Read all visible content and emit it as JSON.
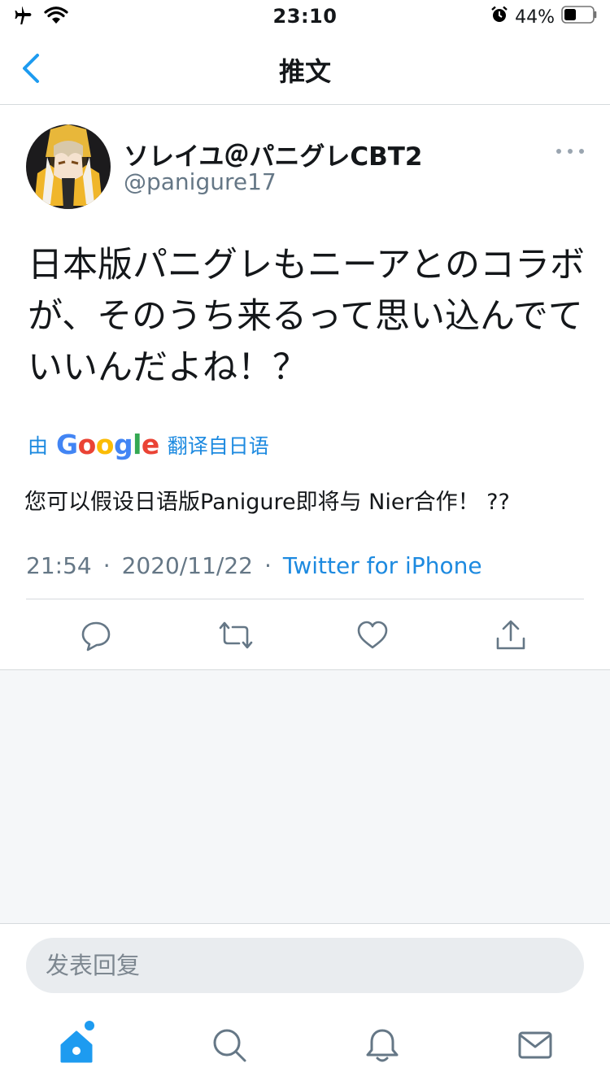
{
  "status_bar": {
    "time": "23:10",
    "battery_percent": "44%",
    "battery_level": 0.44,
    "icons": [
      "airplane-icon",
      "wifi-icon",
      "alarm-icon",
      "battery-icon"
    ]
  },
  "nav": {
    "title": "推文",
    "back_icon": "chevron-left-icon"
  },
  "tweet": {
    "author_name": "ソレイユ＠パニグレCBT2",
    "author_handle": "@panigure17",
    "text": "日本版パニグレもニーアとのコラボが、そのうち来るって思い込んでていいんだよね！？",
    "translate_prefix": "由",
    "translate_brand": "Google",
    "translate_suffix": "翻译自日语",
    "translated_text": "您可以假设日语版Panigure即将与 Nier合作！ ??",
    "time": "21:54",
    "date": "2020/11/22",
    "separator": "·",
    "source": "Twitter for iPhone",
    "actions": [
      "reply-icon",
      "retweet-icon",
      "like-icon",
      "share-icon"
    ]
  },
  "reply": {
    "placeholder": "发表回复"
  },
  "tab_bar": {
    "tabs": [
      "home-icon",
      "search-icon",
      "notifications-icon",
      "messages-icon"
    ]
  },
  "colors": {
    "accent": "#1d9bf0",
    "text": "#14171a",
    "secondary": "#657786",
    "divider": "#d6dadd",
    "background": "#f5f7f9"
  }
}
